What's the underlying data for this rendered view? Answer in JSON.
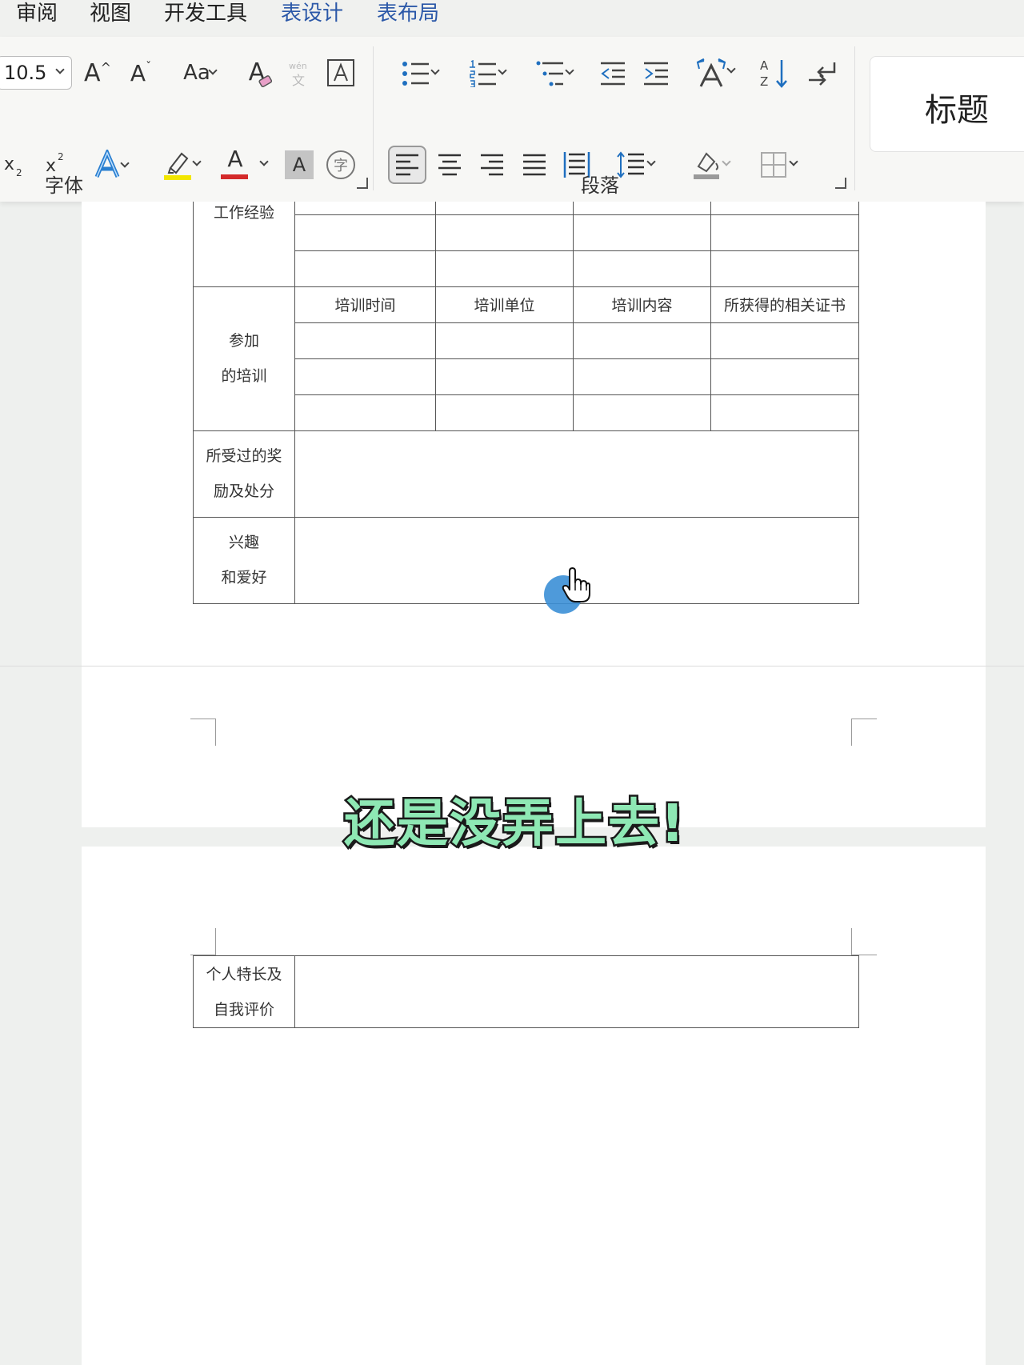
{
  "ribbon_tabs": [
    "审阅",
    "视图",
    "开发工具",
    "表设计",
    "表布局"
  ],
  "font": {
    "size_value": "10.5",
    "grow_label": "A",
    "shrink_label": "A",
    "case_label": "Aa",
    "clear_label": "A",
    "color_label": "A",
    "shade_label": "A",
    "enclose_label": "字",
    "group_label": "字体"
  },
  "paragraph": {
    "group_label": "段落"
  },
  "styles": {
    "title_label": "标题"
  },
  "table1": {
    "work_experience": "工作经验",
    "training_label": "参加\n的培训",
    "training_headers": [
      "培训时间",
      "培训单位",
      "培训内容",
      "所获得的相关证书"
    ],
    "awards_label": "所受过的奖\n励及处分",
    "hobbies_label": "兴趣\n和爱好"
  },
  "table2": {
    "self_label": "个人特长及\n自我评价"
  },
  "subtitle": "还是没弄上去!",
  "colors": {
    "tab_blue": "#2b58a8",
    "subtitle_green": "#8ee8b4",
    "cursor_blue": "#3b8fd6",
    "highlight_yellow": "#f2e600",
    "font_red": "#d42a2a"
  }
}
